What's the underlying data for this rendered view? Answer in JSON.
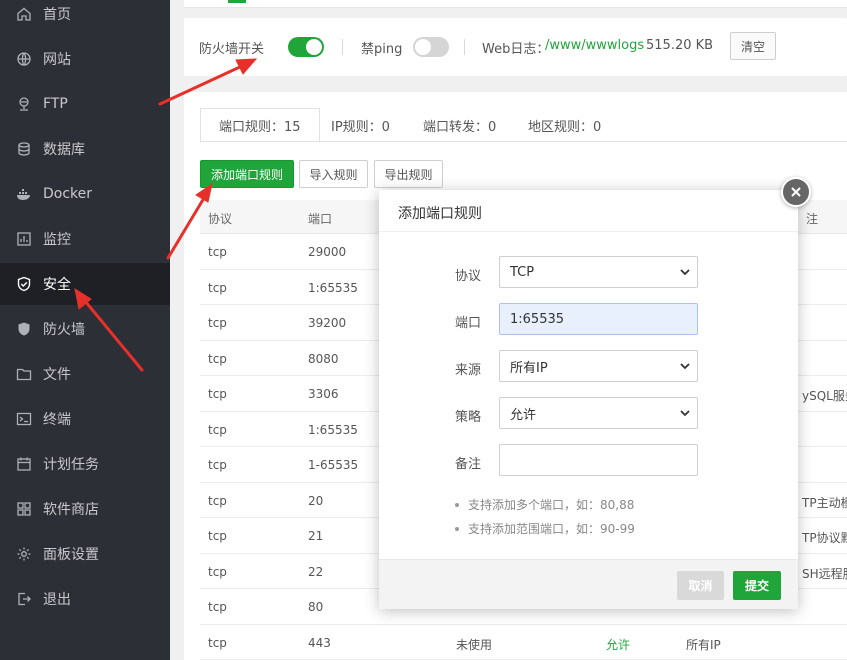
{
  "sidebar": {
    "items": [
      {
        "label": "首页",
        "icon": "home-icon"
      },
      {
        "label": "网站",
        "icon": "globe-icon"
      },
      {
        "label": "FTP",
        "icon": "ftp-icon"
      },
      {
        "label": "数据库",
        "icon": "database-icon"
      },
      {
        "label": "Docker",
        "icon": "docker-icon"
      },
      {
        "label": "监控",
        "icon": "monitor-icon"
      },
      {
        "label": "安全",
        "icon": "shield-icon",
        "active": true
      },
      {
        "label": "防火墙",
        "icon": "firewall-icon"
      },
      {
        "label": "文件",
        "icon": "folder-icon"
      },
      {
        "label": "终端",
        "icon": "terminal-icon"
      },
      {
        "label": "计划任务",
        "icon": "calendar-icon"
      },
      {
        "label": "软件商店",
        "icon": "apps-icon"
      },
      {
        "label": "面板设置",
        "icon": "gear-icon"
      },
      {
        "label": "退出",
        "icon": "logout-icon"
      }
    ]
  },
  "firewall_bar": {
    "firewall_label": "防火墙开关",
    "firewall_on": true,
    "ping_label": "禁ping",
    "ping_on": false,
    "weblog_label": "Web日志：",
    "weblog_path": "/www/wwwlogs",
    "weblog_size": "515.20 KB",
    "clear_label": "清空"
  },
  "tabs": [
    {
      "label": "端口规则：15",
      "active": true
    },
    {
      "label": "IP规则：0"
    },
    {
      "label": "端口转发：0"
    },
    {
      "label": "地区规则：0"
    }
  ],
  "toolbar": {
    "add_label": "添加端口规则",
    "import_label": "导入规则",
    "export_label": "导出规则"
  },
  "table": {
    "headers": {
      "protocol": "协议",
      "port": "端口",
      "remark": "注"
    },
    "rows": [
      {
        "protocol": "tcp",
        "port": "29000",
        "status": "",
        "policy": "",
        "remark": ""
      },
      {
        "protocol": "tcp",
        "port": "1:65535",
        "status": "",
        "policy": "",
        "remark": ""
      },
      {
        "protocol": "tcp",
        "port": "39200",
        "status": "",
        "policy": "",
        "remark": ""
      },
      {
        "protocol": "tcp",
        "port": "8080",
        "status": "",
        "policy": "",
        "remark": ""
      },
      {
        "protocol": "tcp",
        "port": "3306",
        "status": "",
        "policy": "",
        "remark": "ySQL服务"
      },
      {
        "protocol": "tcp",
        "port": "1:65535",
        "status": "",
        "policy": "",
        "remark": ""
      },
      {
        "protocol": "tcp",
        "port": "1-65535",
        "status": "",
        "policy": "",
        "remark": ""
      },
      {
        "protocol": "tcp",
        "port": "20",
        "status": "",
        "policy": "",
        "remark": "TP主动模"
      },
      {
        "protocol": "tcp",
        "port": "21",
        "status": "",
        "policy": "",
        "remark": "TP协议默"
      },
      {
        "protocol": "tcp",
        "port": "22",
        "status": "",
        "policy": "",
        "remark": "SH远程服"
      },
      {
        "protocol": "tcp",
        "port": "80",
        "status": "",
        "policy": "",
        "remark": ""
      },
      {
        "protocol": "tcp",
        "port": "443",
        "status": "未使用",
        "policy": "允许",
        "remark": "所有IP"
      }
    ]
  },
  "modal": {
    "title": "添加端口规则",
    "fields": {
      "protocol_label": "协议",
      "protocol_value": "TCP",
      "port_label": "端口",
      "port_value": "1:65535",
      "source_label": "来源",
      "source_value": "所有IP",
      "policy_label": "策略",
      "policy_value": "允许",
      "remark_label": "备注",
      "remark_value": ""
    },
    "hints": [
      "支持添加多个端口，如：80,88",
      "支持添加范围端口，如：90-99"
    ],
    "cancel_label": "取消",
    "submit_label": "提交"
  },
  "colors": {
    "accent": "#20a53a",
    "sidebar_bg": "#2c2f36",
    "annotation_arrow": "#e8302a"
  }
}
